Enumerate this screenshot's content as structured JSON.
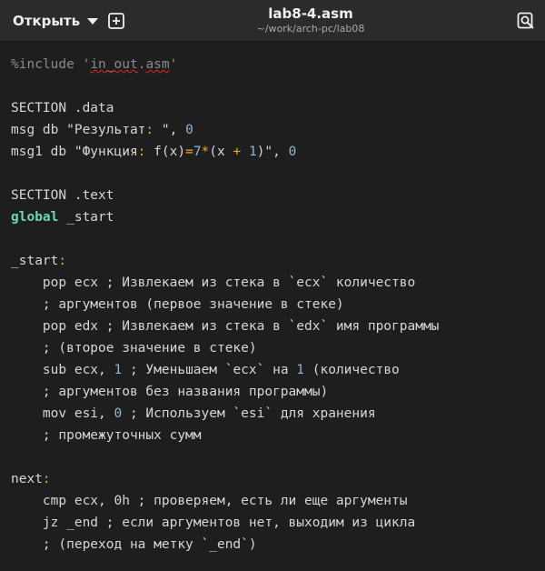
{
  "header": {
    "open_label": "Открыть",
    "title": "lab8-4.asm",
    "subtitle": "~/work/arch-pc/lab08"
  },
  "icons": [
    "chevron-down-icon",
    "new-tab-icon",
    "search-icon"
  ],
  "colors": {
    "background": "#1e1e1e",
    "header": "#2b2b2b",
    "number": "#8fb6d6",
    "operator": "#f5a623",
    "keyword": "#6cd9a8",
    "preprocessor": "#8a8a8a",
    "spell_error": "#e02424"
  },
  "code": {
    "l1": [
      {
        "t": "%include ",
        "c": "pre"
      },
      {
        "t": "'",
        "c": "pre"
      },
      {
        "t": "in_out",
        "c": "pre-err"
      },
      {
        "t": ".",
        "c": "pre"
      },
      {
        "t": "asm",
        "c": "pre-err"
      },
      {
        "t": "'",
        "c": "pre"
      }
    ],
    "l3": [
      {
        "t": "SECTION .data",
        "c": ""
      }
    ],
    "l4": [
      {
        "t": "msg db \"Результат",
        "c": ""
      },
      {
        "t": ":",
        "c": "op"
      },
      {
        "t": " \", ",
        "c": ""
      },
      {
        "t": "0",
        "c": "num"
      }
    ],
    "l5": [
      {
        "t": "msg1 db \"Функция",
        "c": ""
      },
      {
        "t": ":",
        "c": "op"
      },
      {
        "t": " f(x)",
        "c": ""
      },
      {
        "t": "=",
        "c": "op"
      },
      {
        "t": "7",
        "c": "num"
      },
      {
        "t": "*",
        "c": "op"
      },
      {
        "t": "(x ",
        "c": ""
      },
      {
        "t": "+",
        "c": "op"
      },
      {
        "t": " ",
        "c": ""
      },
      {
        "t": "1",
        "c": "num"
      },
      {
        "t": ")\", ",
        "c": ""
      },
      {
        "t": "0",
        "c": "num"
      }
    ],
    "l7": [
      {
        "t": "SECTION .text",
        "c": ""
      }
    ],
    "l8": [
      {
        "t": "global",
        "c": "kw"
      },
      {
        "t": " _start",
        "c": ""
      }
    ],
    "l10": [
      {
        "t": "_start",
        "c": ""
      },
      {
        "t": ":",
        "c": "op"
      }
    ],
    "l11": [
      {
        "t": "    pop ecx ; Извлекаем из стека в `ecx` количество",
        "c": ""
      }
    ],
    "l12": [
      {
        "t": "    ; аргументов (первое значение в стеке)",
        "c": ""
      }
    ],
    "l13": [
      {
        "t": "    pop edx ; Извлекаем из стека в `edx` имя программы",
        "c": ""
      }
    ],
    "l14": [
      {
        "t": "    ; (второе значение в стеке)",
        "c": ""
      }
    ],
    "l15": [
      {
        "t": "    sub ecx, ",
        "c": ""
      },
      {
        "t": "1",
        "c": "num"
      },
      {
        "t": " ; Уменьшаем `ecx` на ",
        "c": ""
      },
      {
        "t": "1",
        "c": "num"
      },
      {
        "t": " (количество",
        "c": ""
      }
    ],
    "l16": [
      {
        "t": "    ; аргументов без названия программы)",
        "c": ""
      }
    ],
    "l17": [
      {
        "t": "    mov esi, ",
        "c": ""
      },
      {
        "t": "0",
        "c": "num"
      },
      {
        "t": " ; Используем `esi` для хранения",
        "c": ""
      }
    ],
    "l18": [
      {
        "t": "    ; промежуточных сумм",
        "c": ""
      }
    ],
    "l20": [
      {
        "t": "next",
        "c": ""
      },
      {
        "t": ":",
        "c": "op"
      }
    ],
    "l21": [
      {
        "t": "    cmp ecx, 0h ; проверяем, есть ли еще аргументы",
        "c": ""
      }
    ],
    "l22": [
      {
        "t": "    jz _end ; если аргументов нет, выходим из цикла",
        "c": ""
      }
    ],
    "l23": [
      {
        "t": "    ; (переход на метку `_end`)",
        "c": ""
      }
    ]
  }
}
